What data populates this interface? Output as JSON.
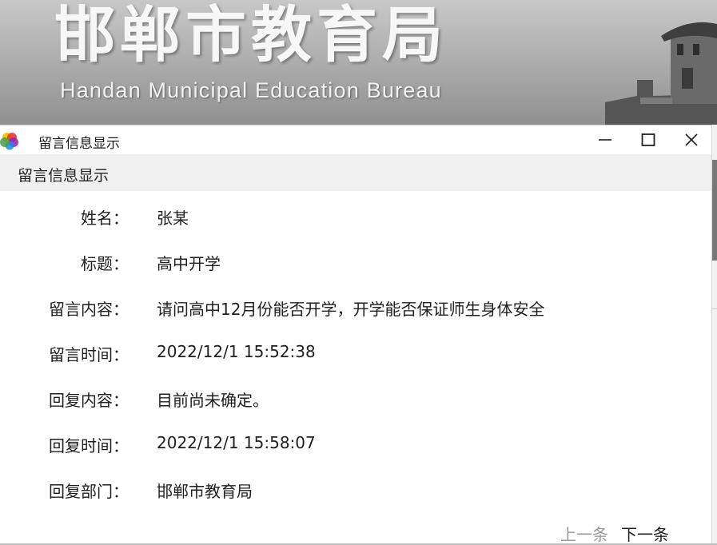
{
  "background": {
    "banner_title": "邯郸市教育局",
    "banner_subtitle": "Handan Municipal Education Bureau"
  },
  "window": {
    "title": "留言信息显示",
    "controls": {
      "minimize_icon": "minimize-icon",
      "maximize_icon": "maximize-icon",
      "close_icon": "close-icon"
    }
  },
  "header": {
    "title": "留言信息显示"
  },
  "fields": [
    {
      "label": "姓名：",
      "value": "张某"
    },
    {
      "label": "标题：",
      "value": "高中开学"
    },
    {
      "label": "留言内容：",
      "value": "请问高中12月份能否开学，开学能否保证师生身体安全"
    },
    {
      "label": "留言时间：",
      "value": "2022/12/1 15:52:38"
    },
    {
      "label": "回复内容：",
      "value": "目前尚未确定。"
    },
    {
      "label": "回复时间：",
      "value": "2022/12/1 15:58:07"
    },
    {
      "label": "回复部门：",
      "value": "邯郸市教育局"
    }
  ],
  "navigation": {
    "prev_label": "上一条",
    "next_label": "下一条"
  }
}
